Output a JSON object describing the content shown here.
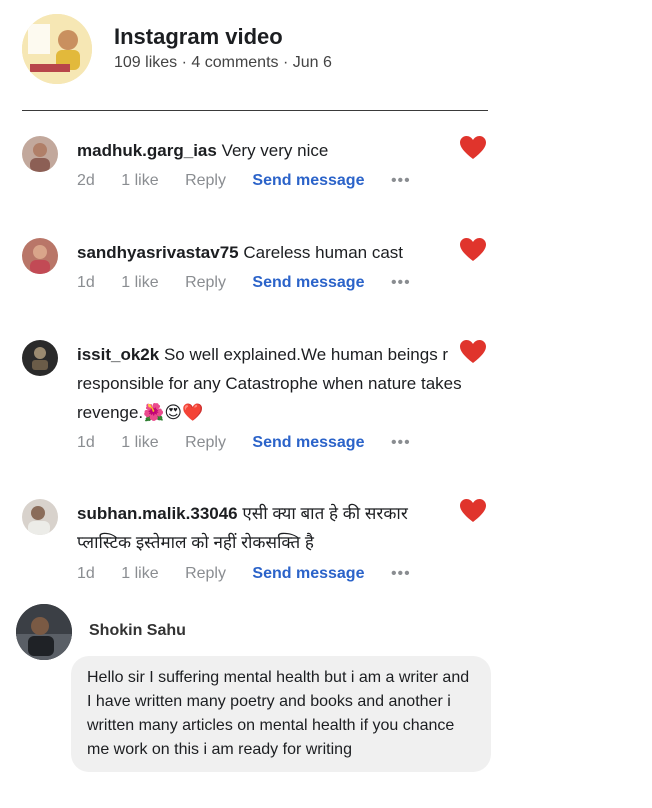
{
  "post": {
    "title": "Instagram video",
    "meta": "109 likes · 4 comments · Jun 6"
  },
  "comments": [
    {
      "user": "madhuk.garg_ias",
      "text": "Very very nice",
      "time": "2d",
      "likes": "1 like",
      "reply": "Reply",
      "send": "Send message",
      "more": "•••"
    },
    {
      "user": "sandhyasrivastav75",
      "text": "Careless human cast",
      "time": "1d",
      "likes": "1 like",
      "reply": "Reply",
      "send": "Send message",
      "more": "•••"
    },
    {
      "user": "issit_ok2k",
      "text": "So well explained.We human beings r responsible for any Catastrophe when nature takes revenge.🌺😍❤️",
      "time": "1d",
      "likes": "1 like",
      "reply": "Reply",
      "send": "Send message",
      "more": "•••"
    },
    {
      "user": "subhan.malik.33046",
      "text": "एसी क्या बात हे की सरकार प्लास्टिक इस्तेमाल को नहीं रोकसक्ति है",
      "time": "1d",
      "likes": "1 like",
      "reply": "Reply",
      "send": "Send message",
      "more": "•••"
    }
  ],
  "reply": {
    "user": "Shokin Sahu",
    "text": "Hello sir I suffering mental health but i am a writer and I have written many poetry and books and another i written many articles on mental health if you chance me work on this i am ready for writing"
  },
  "colors": {
    "heart": "#e0342c",
    "send_message": "#2b63c9",
    "action_gray": "#8a8d91",
    "bubble": "#f0f0f0"
  }
}
